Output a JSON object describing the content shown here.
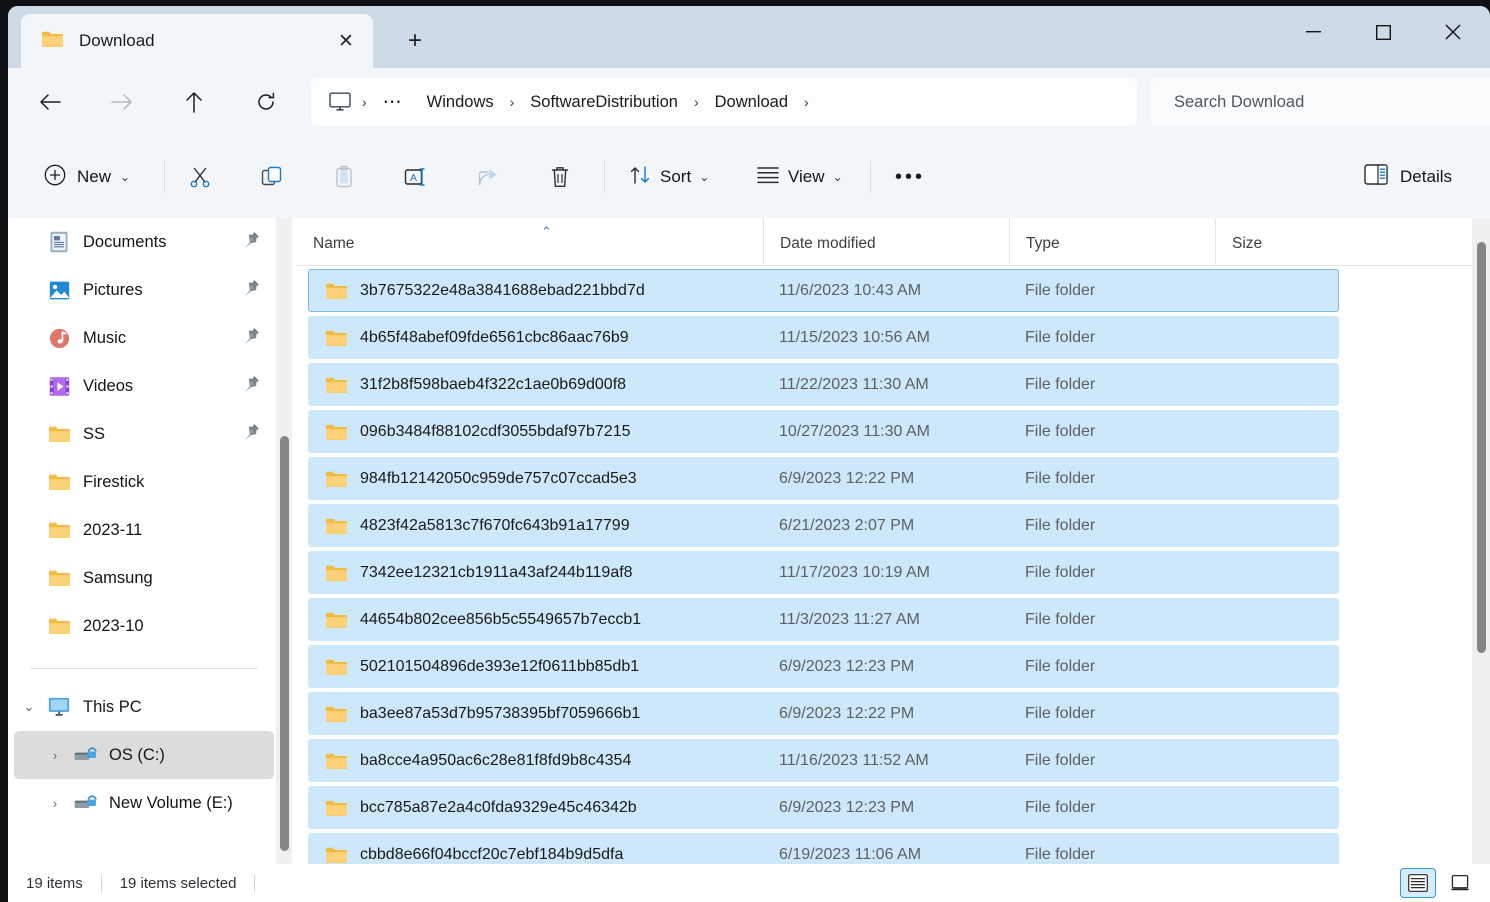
{
  "window": {
    "tab_title": "Download",
    "tab_icon": "folder-icon",
    "close_tab_glyph": "✕",
    "new_tab_glyph": "+",
    "minimize_glyph": "—",
    "maximize_glyph": "☐",
    "close_glyph": "✕"
  },
  "nav": {
    "back": "←",
    "forward": "→",
    "up": "↑",
    "refresh": "↻"
  },
  "breadcrumb": {
    "root_icon": "this-pc-icon",
    "separator": "›",
    "overflow": "⋯",
    "items": [
      "Windows",
      "SoftwareDistribution",
      "Download"
    ]
  },
  "search": {
    "placeholder": "Search Download"
  },
  "toolbar": {
    "new_label": "New",
    "chevron": "⌄",
    "cut_label": "Cut",
    "copy_label": "Copy",
    "paste_label": "Paste",
    "rename_label": "Rename",
    "share_label": "Share",
    "delete_label": "Delete",
    "sort_label": "Sort",
    "view_label": "View",
    "more_label": "•••",
    "details_label": "Details"
  },
  "sidebar": {
    "items": [
      {
        "label": "Documents",
        "icon": "documents-icon",
        "pinned": true,
        "indent": 0,
        "twisty": "",
        "selected": false
      },
      {
        "label": "Pictures",
        "icon": "pictures-icon",
        "pinned": true,
        "indent": 0,
        "twisty": "",
        "selected": false
      },
      {
        "label": "Music",
        "icon": "music-icon",
        "pinned": true,
        "indent": 0,
        "twisty": "",
        "selected": false
      },
      {
        "label": "Videos",
        "icon": "videos-icon",
        "pinned": true,
        "indent": 0,
        "twisty": "",
        "selected": false
      },
      {
        "label": "SS",
        "icon": "folder-icon",
        "pinned": true,
        "indent": 0,
        "twisty": "",
        "selected": false
      },
      {
        "label": "Firestick",
        "icon": "folder-icon",
        "pinned": false,
        "indent": 0,
        "twisty": "",
        "selected": false
      },
      {
        "label": "2023-11",
        "icon": "folder-icon",
        "pinned": false,
        "indent": 0,
        "twisty": "",
        "selected": false
      },
      {
        "label": "Samsung",
        "icon": "folder-icon",
        "pinned": false,
        "indent": 0,
        "twisty": "",
        "selected": false
      },
      {
        "label": "2023-10",
        "icon": "folder-icon",
        "pinned": false,
        "indent": 0,
        "twisty": "",
        "selected": false
      }
    ],
    "tree": [
      {
        "label": "This PC",
        "icon": "this-pc-icon",
        "twisty": "⌄",
        "selected": false,
        "indent": 0
      },
      {
        "label": "OS (C:)",
        "icon": "drive-icon",
        "twisty": "›",
        "selected": true,
        "indent": 1
      },
      {
        "label": "New Volume (E:)",
        "icon": "drive-icon",
        "twisty": "›",
        "selected": false,
        "indent": 1
      }
    ]
  },
  "filelist": {
    "columns": [
      "Name",
      "Date modified",
      "Type",
      "Size"
    ],
    "sort_column": "Name",
    "sort_direction": "ascending",
    "sort_glyph": "⌃",
    "rows": [
      {
        "name": "3b7675322e48a3841688ebad221bbd7d",
        "date": "11/6/2023 10:43 AM",
        "type": "File folder",
        "size": "",
        "selected": true,
        "focused": true
      },
      {
        "name": "4b65f48abef09fde6561cbc86aac76b9",
        "date": "11/15/2023 10:56 AM",
        "type": "File folder",
        "size": "",
        "selected": true,
        "focused": false
      },
      {
        "name": "31f2b8f598baeb4f322c1ae0b69d00f8",
        "date": "11/22/2023 11:30 AM",
        "type": "File folder",
        "size": "",
        "selected": true,
        "focused": false
      },
      {
        "name": "096b3484f88102cdf3055bdaf97b7215",
        "date": "10/27/2023 11:30 AM",
        "type": "File folder",
        "size": "",
        "selected": true,
        "focused": false
      },
      {
        "name": "984fb12142050c959de757c07ccad5e3",
        "date": "6/9/2023 12:22 PM",
        "type": "File folder",
        "size": "",
        "selected": true,
        "focused": false
      },
      {
        "name": "4823f42a5813c7f670fc643b91a17799",
        "date": "6/21/2023 2:07 PM",
        "type": "File folder",
        "size": "",
        "selected": true,
        "focused": false
      },
      {
        "name": "7342ee12321cb1911a43af244b119af8",
        "date": "11/17/2023 10:19 AM",
        "type": "File folder",
        "size": "",
        "selected": true,
        "focused": false
      },
      {
        "name": "44654b802cee856b5c5549657b7eccb1",
        "date": "11/3/2023 11:27 AM",
        "type": "File folder",
        "size": "",
        "selected": true,
        "focused": false
      },
      {
        "name": "502101504896de393e12f0611bb85db1",
        "date": "6/9/2023 12:23 PM",
        "type": "File folder",
        "size": "",
        "selected": true,
        "focused": false
      },
      {
        "name": "ba3ee87a53d7b95738395bf7059666b1",
        "date": "6/9/2023 12:22 PM",
        "type": "File folder",
        "size": "",
        "selected": true,
        "focused": false
      },
      {
        "name": "ba8cce4a950ac6c28e81f8fd9b8c4354",
        "date": "11/16/2023 11:52 AM",
        "type": "File folder",
        "size": "",
        "selected": true,
        "focused": false
      },
      {
        "name": "bcc785a87e2a4c0fda9329e45c46342b",
        "date": "6/9/2023 12:23 PM",
        "type": "File folder",
        "size": "",
        "selected": true,
        "focused": false
      },
      {
        "name": "cbbd8e66f04bccf20c7ebf184b9d5dfa",
        "date": "6/19/2023 11:06 AM",
        "type": "File folder",
        "size": "",
        "selected": true,
        "focused": false
      }
    ]
  },
  "statusbar": {
    "item_count": "19 items",
    "selection_count": "19 items selected",
    "details_view_label": "Details view",
    "large_icons_view_label": "Large icons view"
  },
  "colors": {
    "titlebar": "#cddbe8",
    "chrome": "#f3f6f9",
    "selection": "#cde8fa",
    "selection_border": "#7bbbe4",
    "accent": "#2e9ae0",
    "folder": "#f6c656"
  }
}
